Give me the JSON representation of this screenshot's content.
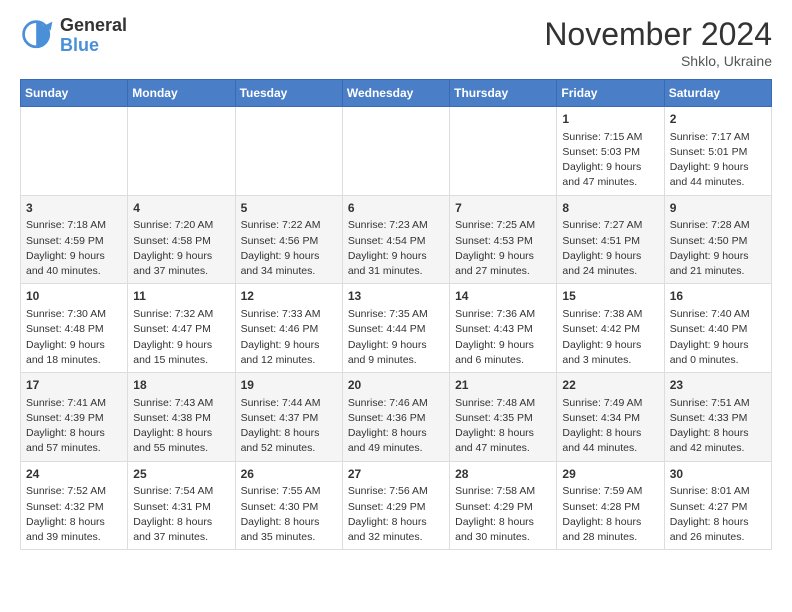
{
  "logo": {
    "general": "General",
    "blue": "Blue"
  },
  "title": "November 2024",
  "location": "Shklo, Ukraine",
  "days_of_week": [
    "Sunday",
    "Monday",
    "Tuesday",
    "Wednesday",
    "Thursday",
    "Friday",
    "Saturday"
  ],
  "weeks": [
    [
      {
        "day": "",
        "info": ""
      },
      {
        "day": "",
        "info": ""
      },
      {
        "day": "",
        "info": ""
      },
      {
        "day": "",
        "info": ""
      },
      {
        "day": "",
        "info": ""
      },
      {
        "day": "1",
        "info": "Sunrise: 7:15 AM\nSunset: 5:03 PM\nDaylight: 9 hours and 47 minutes."
      },
      {
        "day": "2",
        "info": "Sunrise: 7:17 AM\nSunset: 5:01 PM\nDaylight: 9 hours and 44 minutes."
      }
    ],
    [
      {
        "day": "3",
        "info": "Sunrise: 7:18 AM\nSunset: 4:59 PM\nDaylight: 9 hours and 40 minutes."
      },
      {
        "day": "4",
        "info": "Sunrise: 7:20 AM\nSunset: 4:58 PM\nDaylight: 9 hours and 37 minutes."
      },
      {
        "day": "5",
        "info": "Sunrise: 7:22 AM\nSunset: 4:56 PM\nDaylight: 9 hours and 34 minutes."
      },
      {
        "day": "6",
        "info": "Sunrise: 7:23 AM\nSunset: 4:54 PM\nDaylight: 9 hours and 31 minutes."
      },
      {
        "day": "7",
        "info": "Sunrise: 7:25 AM\nSunset: 4:53 PM\nDaylight: 9 hours and 27 minutes."
      },
      {
        "day": "8",
        "info": "Sunrise: 7:27 AM\nSunset: 4:51 PM\nDaylight: 9 hours and 24 minutes."
      },
      {
        "day": "9",
        "info": "Sunrise: 7:28 AM\nSunset: 4:50 PM\nDaylight: 9 hours and 21 minutes."
      }
    ],
    [
      {
        "day": "10",
        "info": "Sunrise: 7:30 AM\nSunset: 4:48 PM\nDaylight: 9 hours and 18 minutes."
      },
      {
        "day": "11",
        "info": "Sunrise: 7:32 AM\nSunset: 4:47 PM\nDaylight: 9 hours and 15 minutes."
      },
      {
        "day": "12",
        "info": "Sunrise: 7:33 AM\nSunset: 4:46 PM\nDaylight: 9 hours and 12 minutes."
      },
      {
        "day": "13",
        "info": "Sunrise: 7:35 AM\nSunset: 4:44 PM\nDaylight: 9 hours and 9 minutes."
      },
      {
        "day": "14",
        "info": "Sunrise: 7:36 AM\nSunset: 4:43 PM\nDaylight: 9 hours and 6 minutes."
      },
      {
        "day": "15",
        "info": "Sunrise: 7:38 AM\nSunset: 4:42 PM\nDaylight: 9 hours and 3 minutes."
      },
      {
        "day": "16",
        "info": "Sunrise: 7:40 AM\nSunset: 4:40 PM\nDaylight: 9 hours and 0 minutes."
      }
    ],
    [
      {
        "day": "17",
        "info": "Sunrise: 7:41 AM\nSunset: 4:39 PM\nDaylight: 8 hours and 57 minutes."
      },
      {
        "day": "18",
        "info": "Sunrise: 7:43 AM\nSunset: 4:38 PM\nDaylight: 8 hours and 55 minutes."
      },
      {
        "day": "19",
        "info": "Sunrise: 7:44 AM\nSunset: 4:37 PM\nDaylight: 8 hours and 52 minutes."
      },
      {
        "day": "20",
        "info": "Sunrise: 7:46 AM\nSunset: 4:36 PM\nDaylight: 8 hours and 49 minutes."
      },
      {
        "day": "21",
        "info": "Sunrise: 7:48 AM\nSunset: 4:35 PM\nDaylight: 8 hours and 47 minutes."
      },
      {
        "day": "22",
        "info": "Sunrise: 7:49 AM\nSunset: 4:34 PM\nDaylight: 8 hours and 44 minutes."
      },
      {
        "day": "23",
        "info": "Sunrise: 7:51 AM\nSunset: 4:33 PM\nDaylight: 8 hours and 42 minutes."
      }
    ],
    [
      {
        "day": "24",
        "info": "Sunrise: 7:52 AM\nSunset: 4:32 PM\nDaylight: 8 hours and 39 minutes."
      },
      {
        "day": "25",
        "info": "Sunrise: 7:54 AM\nSunset: 4:31 PM\nDaylight: 8 hours and 37 minutes."
      },
      {
        "day": "26",
        "info": "Sunrise: 7:55 AM\nSunset: 4:30 PM\nDaylight: 8 hours and 35 minutes."
      },
      {
        "day": "27",
        "info": "Sunrise: 7:56 AM\nSunset: 4:29 PM\nDaylight: 8 hours and 32 minutes."
      },
      {
        "day": "28",
        "info": "Sunrise: 7:58 AM\nSunset: 4:29 PM\nDaylight: 8 hours and 30 minutes."
      },
      {
        "day": "29",
        "info": "Sunrise: 7:59 AM\nSunset: 4:28 PM\nDaylight: 8 hours and 28 minutes."
      },
      {
        "day": "30",
        "info": "Sunrise: 8:01 AM\nSunset: 4:27 PM\nDaylight: 8 hours and 26 minutes."
      }
    ]
  ]
}
